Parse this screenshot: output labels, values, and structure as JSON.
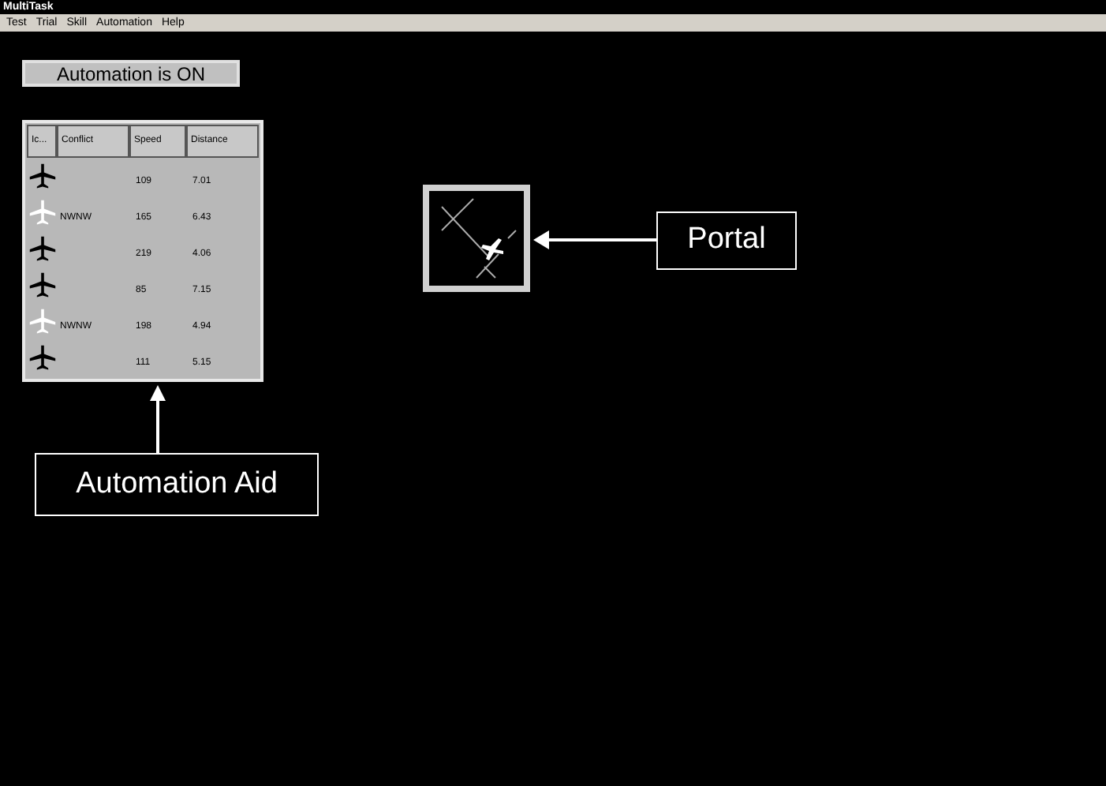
{
  "window": {
    "title": "MultiTask"
  },
  "menu": [
    "Test",
    "Trial",
    "Skill",
    "Automation",
    "Help"
  ],
  "status": {
    "text": "Automation is ON",
    "on": true
  },
  "table": {
    "columns": [
      "Ic...",
      "Conflict",
      "Speed",
      "Distance"
    ],
    "rows": [
      {
        "highlighted": false,
        "conflict": "",
        "speed": "109",
        "distance": "7.01"
      },
      {
        "highlighted": true,
        "conflict": "NWNW",
        "speed": "165",
        "distance": "6.43"
      },
      {
        "highlighted": false,
        "conflict": "",
        "speed": "219",
        "distance": "4.06"
      },
      {
        "highlighted": false,
        "conflict": "",
        "speed": "85",
        "distance": "7.15"
      },
      {
        "highlighted": true,
        "conflict": "NWNW",
        "speed": "198",
        "distance": "4.94"
      },
      {
        "highlighted": false,
        "conflict": "",
        "speed": "111",
        "distance": "5.15"
      }
    ]
  },
  "callouts": {
    "table_label": "Automation Aid",
    "portal_label": "Portal"
  }
}
